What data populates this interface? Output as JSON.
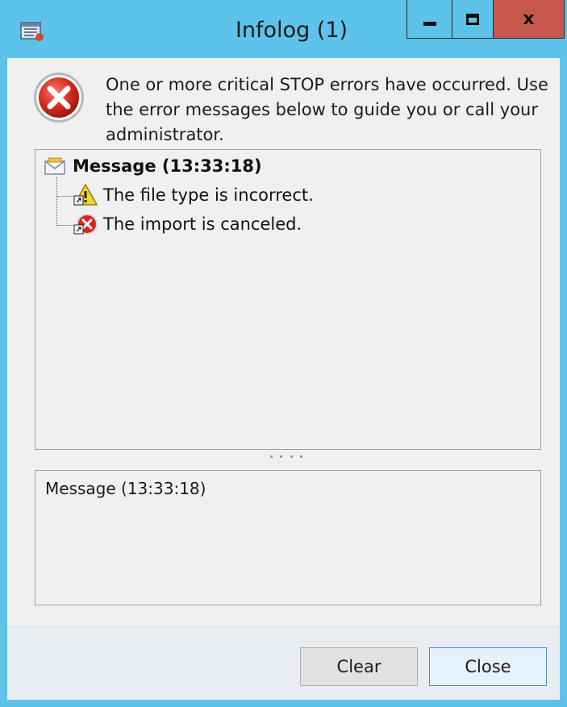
{
  "window": {
    "title": "Infolog (1)",
    "close_glyph": "x",
    "colors": {
      "frame": "#5ec3ea",
      "close_button": "#c8584e",
      "client": "#f0f0f0"
    }
  },
  "summary": {
    "icon": "error-icon",
    "text": "One or more critical STOP errors have occurred. Use the error messages below to guide you or call your administrator."
  },
  "tree": {
    "root": {
      "icon": "message-icon",
      "label": "Message (13:33:18)"
    },
    "children": [
      {
        "icon": "warning-icon",
        "label": "The file type is incorrect."
      },
      {
        "icon": "error-small-icon",
        "label": "The import is canceled."
      }
    ]
  },
  "detail": {
    "text": "Message (13:33:18)"
  },
  "footer": {
    "clear_label": "Clear",
    "close_label": "Close"
  }
}
